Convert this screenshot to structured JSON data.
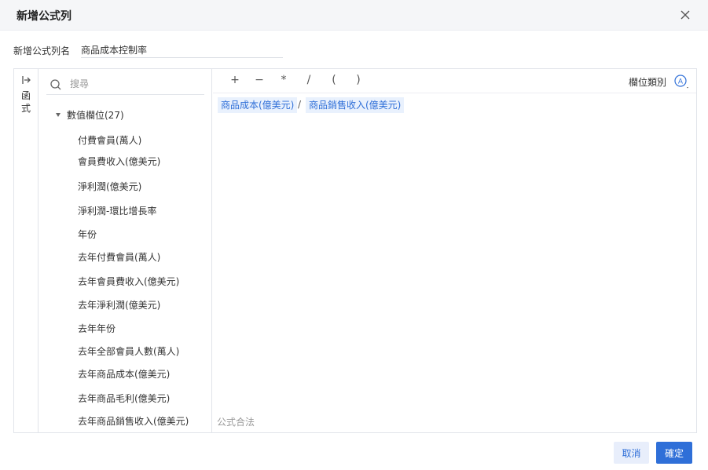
{
  "dialog": {
    "title": "新增公式列",
    "close_icon": "close-icon"
  },
  "name_field": {
    "label": "新增公式列名",
    "value": "商品成本控制率"
  },
  "side_tab": {
    "label": "函式"
  },
  "fields_panel": {
    "search_placeholder": "搜尋",
    "group_label": "數值欄位(27)",
    "items": [
      "付費會員(萬人)",
      "會員費收入(億美元)",
      "淨利潤(億美元)",
      "淨利潤-環比增長率",
      "年份",
      "去年付費會員(萬人)",
      "去年會員費收入(億美元)",
      "去年淨利潤(億美元)",
      "去年年份",
      "去年全部會員人數(萬人)",
      "去年商品成本(億美元)",
      "去年商品毛利(億美元)",
      "去年商品銷售收入(億美元)"
    ]
  },
  "toolbar": {
    "operators": [
      "+",
      "−",
      "*",
      "/",
      "(",
      ")"
    ],
    "type_label": "欄位類別",
    "type_icon": "circled-a-icon"
  },
  "formula": {
    "left_operand": "商品成本(億美元)",
    "operator": "/",
    "right_operand": "商品銷售收入(億美元)",
    "status": "公式合法"
  },
  "buttons": {
    "cancel": "取消",
    "ok": "確定"
  },
  "colors": {
    "accent": "#2f6fd8",
    "chip_bg": "#e9f1fd",
    "header_bg": "#f5f6f8"
  }
}
